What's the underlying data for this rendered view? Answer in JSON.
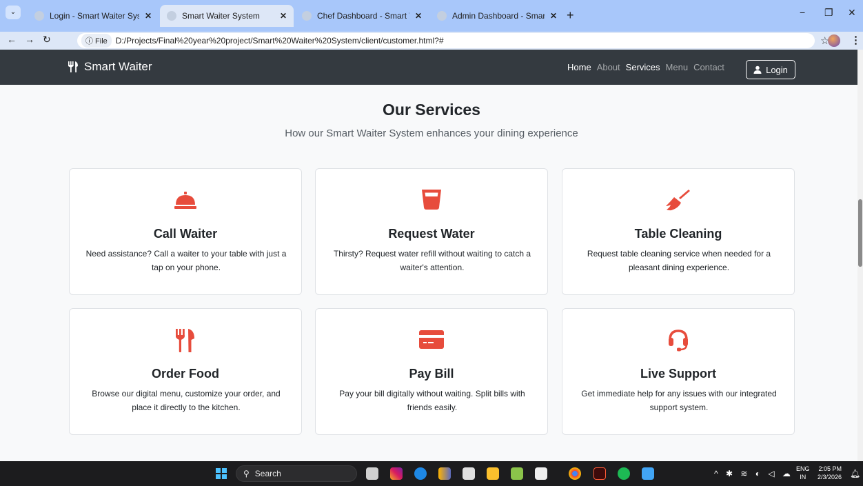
{
  "browser": {
    "tabs": [
      {
        "title": "Login - Smart Waiter System"
      },
      {
        "title": "Smart Waiter System"
      },
      {
        "title": "Chef Dashboard - Smart Waiter"
      },
      {
        "title": "Admin Dashboard - Smart Waiter"
      }
    ],
    "tab_close": "✕",
    "new_tab": "+",
    "url_chip": "ⓘ File",
    "url": "D:/Projects/Final%20year%20project/Smart%20Waiter%20System/client/customer.html?#"
  },
  "navbar": {
    "brand": "Smart Waiter",
    "links": [
      {
        "label": "Home"
      },
      {
        "label": "About"
      },
      {
        "label": "Services"
      },
      {
        "label": "Menu"
      },
      {
        "label": "Contact"
      }
    ],
    "login_label": "Login"
  },
  "services": {
    "title": "Our Services",
    "subtitle": "How our Smart Waiter System enhances your dining experience",
    "accent_color": "#e74c3c",
    "items": [
      {
        "icon": "bell-concierge-icon",
        "title": "Call Waiter",
        "description": "Need assistance? Call a waiter to your table with just a tap on your phone."
      },
      {
        "icon": "glass-water-icon",
        "title": "Request Water",
        "description": "Thirsty? Request water refill without waiting to catch a waiter's attention."
      },
      {
        "icon": "broom-icon",
        "title": "Table Cleaning",
        "description": "Request table cleaning service when needed for a pleasant dining experience."
      },
      {
        "icon": "utensils-icon",
        "title": "Order Food",
        "description": "Browse our digital menu, customize your order, and place it directly to the kitchen."
      },
      {
        "icon": "credit-card-icon",
        "title": "Pay Bill",
        "description": "Pay your bill digitally without waiting. Split bills with friends easily."
      },
      {
        "icon": "headset-icon",
        "title": "Live Support",
        "description": "Get immediate help for any issues with our integrated support system."
      }
    ]
  },
  "taskbar": {
    "search_placeholder": "Search",
    "language": "ENG",
    "region": "IN",
    "time": "2:05 PM",
    "date": "2/3/2026"
  }
}
